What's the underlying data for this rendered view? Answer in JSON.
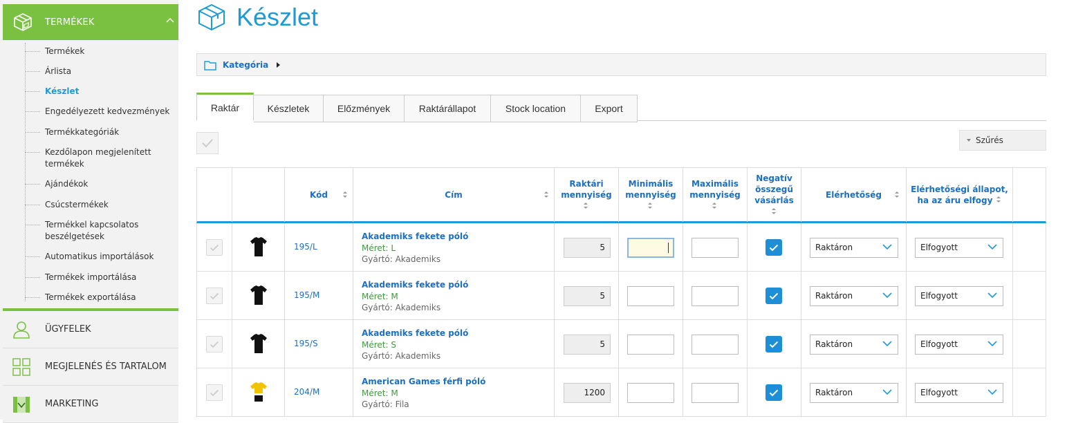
{
  "sidebar": {
    "active_section": {
      "title": "TERMÉKEK",
      "icon": "box-icon"
    },
    "subitems": [
      {
        "label": "Termékek"
      },
      {
        "label": "Árlista"
      },
      {
        "label": "Készlet",
        "active": true
      },
      {
        "label": "Engedélyezett kedvezmények"
      },
      {
        "label": "Termékkategóriák"
      },
      {
        "label": "Kezdőlapon megjelenített termékek"
      },
      {
        "label": "Ajándékok"
      },
      {
        "label": "Csúcstermékek"
      },
      {
        "label": "Termékkel kapcsolatos beszélgetések"
      },
      {
        "label": "Automatikus importálások"
      },
      {
        "label": "Termékek importálása"
      },
      {
        "label": "Termékek exportálása"
      }
    ],
    "sections": [
      {
        "title": "ÜGYFELEK",
        "icon": "user-icon"
      },
      {
        "title": "MEGJELENÉS ÉS TARTALOM",
        "icon": "layout-grid-icon"
      },
      {
        "title": "MARKETING",
        "icon": "marketing-icon"
      }
    ]
  },
  "header": {
    "title": "Készlet",
    "icon": "box-icon"
  },
  "category_bar": {
    "label": "Kategória"
  },
  "tabs": [
    {
      "label": "Raktár",
      "active": true
    },
    {
      "label": "Készletek"
    },
    {
      "label": "Előzmények"
    },
    {
      "label": "Raktárállapot"
    },
    {
      "label": "Stock location"
    },
    {
      "label": "Export"
    }
  ],
  "filter": {
    "label": "Szűrés"
  },
  "table": {
    "columns": {
      "code": "Kód",
      "title": "Cím",
      "stock_qty_1": "Raktári",
      "stock_qty_2": "mennyiség",
      "min_qty_1": "Minimális",
      "min_qty_2": "mennyiség",
      "max_qty_1": "Maximális",
      "max_qty_2": "mennyiség",
      "negative_1": "Negatív",
      "negative_2": "összegű",
      "negative_3": "vásárlás",
      "availability": "Elérhetőség",
      "soldout_1": "Elérhetőségi állapot,",
      "soldout_2": "ha az áru elfogy"
    },
    "rows": [
      {
        "code": "195/L",
        "name": "Akademiks fekete póló",
        "size": "Méret: L",
        "manufacturer": "Gyártó: Akademiks",
        "stock": "5",
        "min": "",
        "max": "",
        "negative": true,
        "availability": "Raktáron",
        "soldout_state": "Elfogyott",
        "thumb": "black-tshirt"
      },
      {
        "code": "195/M",
        "name": "Akademiks fekete póló",
        "size": "Méret: M",
        "manufacturer": "Gyártó: Akademiks",
        "stock": "5",
        "min": "",
        "max": "",
        "negative": true,
        "availability": "Raktáron",
        "soldout_state": "Elfogyott",
        "thumb": "black-tshirt"
      },
      {
        "code": "195/S",
        "name": "Akademiks fekete póló",
        "size": "Méret: S",
        "manufacturer": "Gyártó: Akademiks",
        "stock": "5",
        "min": "",
        "max": "",
        "negative": true,
        "availability": "Raktáron",
        "soldout_state": "Elfogyott",
        "thumb": "black-tshirt"
      },
      {
        "code": "204/M",
        "name": "American Games férfi póló",
        "size": "Méret: M",
        "manufacturer": "Gyártó: Fila",
        "stock": "1200",
        "min": "",
        "max": "",
        "negative": true,
        "availability": "Raktáron",
        "soldout_state": "Elfogyott",
        "thumb": "yellow-black-tshirt"
      }
    ]
  },
  "colors": {
    "accent_green": "#7ac142",
    "accent_blue": "#1e9ad6",
    "link_blue": "#1e6fbf"
  }
}
